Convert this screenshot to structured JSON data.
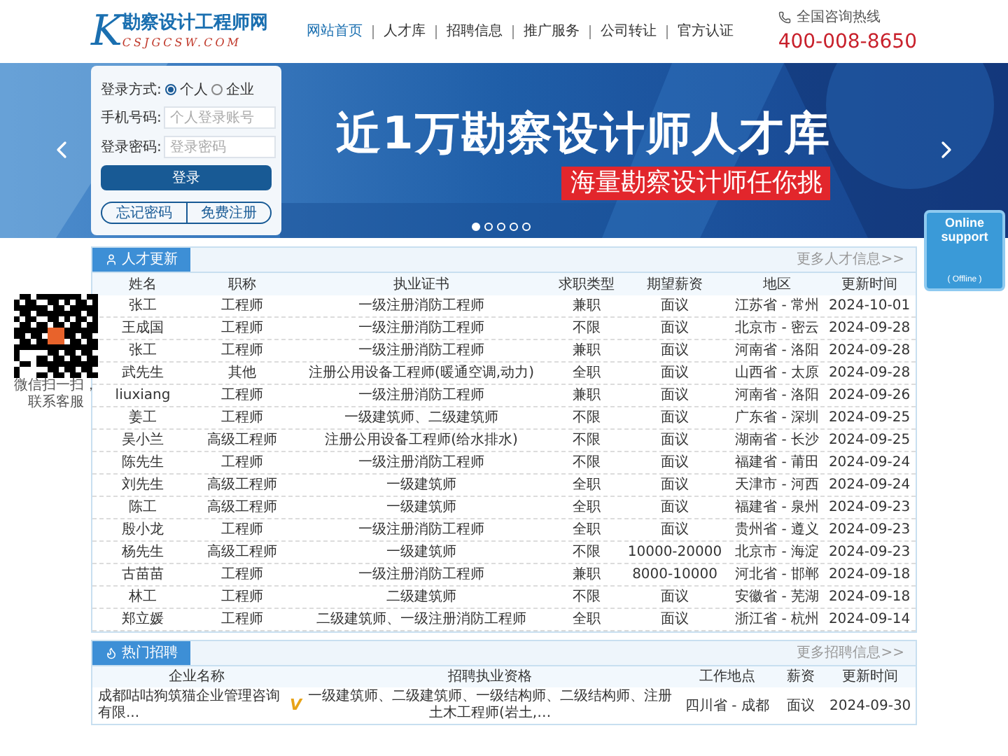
{
  "header": {
    "logo_letter": "K",
    "logo_title": "勘察设计工程师网",
    "logo_domain": "CSJGCSW.COM",
    "nav": [
      {
        "label": "网站首页",
        "selected": true
      },
      {
        "label": "人才库",
        "selected": false
      },
      {
        "label": "招聘信息",
        "selected": false
      },
      {
        "label": "推广服务",
        "selected": false
      },
      {
        "label": "公司转让",
        "selected": false
      },
      {
        "label": "官方认证",
        "selected": false
      }
    ],
    "hotline_label": "全国咨询热线",
    "hotline": "400-008-8650"
  },
  "banner": {
    "headline": "近1万勘察设计师人才库",
    "tagline": "海量勘察设计师任你挑",
    "dots": [
      {
        "selected": true
      },
      {
        "selected": false
      },
      {
        "selected": false
      },
      {
        "selected": false
      },
      {
        "selected": false
      }
    ]
  },
  "login": {
    "mode_label": "登录方式:",
    "modes": [
      {
        "label": "个人",
        "selected": true
      },
      {
        "label": "企业",
        "selected": false
      }
    ],
    "phone_label": "手机号码:",
    "phone_placeholder": "个人登录账号",
    "password_label": "登录密码:",
    "password_placeholder": "登录密码",
    "login_button": "登录",
    "forgot": "忘记密码",
    "register": "免费注册"
  },
  "qr_caption": "微信扫一扫，联系客服",
  "support_widget": {
    "title": "Online support",
    "status": "( Offline )"
  },
  "talent": {
    "tab": "人才更新",
    "more": "更多人才信息>>",
    "columns": [
      "姓名",
      "职称",
      "执业证书",
      "求职类型",
      "期望薪资",
      "地区",
      "更新时间"
    ],
    "rows": [
      [
        "张工",
        "工程师",
        "一级注册消防工程师",
        "兼职",
        "面议",
        "江苏省 - 常州",
        "2024-10-01"
      ],
      [
        "王成国",
        "工程师",
        "一级注册消防工程师",
        "不限",
        "面议",
        "北京市 - 密云",
        "2024-09-28"
      ],
      [
        "张工",
        "工程师",
        "一级注册消防工程师",
        "兼职",
        "面议",
        "河南省 - 洛阳",
        "2024-09-28"
      ],
      [
        "武先生",
        "其他",
        "注册公用设备工程师(暖通空调,动力)",
        "全职",
        "面议",
        "山西省 - 太原",
        "2024-09-28"
      ],
      [
        "liuxiang",
        "工程师",
        "一级注册消防工程师",
        "兼职",
        "面议",
        "河南省 - 洛阳",
        "2024-09-26"
      ],
      [
        "姜工",
        "工程师",
        "一级建筑师、二级建筑师",
        "不限",
        "面议",
        "广东省 - 深圳",
        "2024-09-25"
      ],
      [
        "吴小兰",
        "高级工程师",
        "注册公用设备工程师(给水排水)",
        "不限",
        "面议",
        "湖南省 - 长沙",
        "2024-09-25"
      ],
      [
        "陈先生",
        "工程师",
        "一级注册消防工程师",
        "不限",
        "面议",
        "福建省 - 莆田",
        "2024-09-24"
      ],
      [
        "刘先生",
        "高级工程师",
        "一级建筑师",
        "全职",
        "面议",
        "天津市 - 河西",
        "2024-09-24"
      ],
      [
        "陈工",
        "高级工程师",
        "一级建筑师",
        "全职",
        "面议",
        "福建省 - 泉州",
        "2024-09-23"
      ],
      [
        "殷小龙",
        "工程师",
        "一级注册消防工程师",
        "全职",
        "面议",
        "贵州省 - 遵义",
        "2024-09-23"
      ],
      [
        "杨先生",
        "高级工程师",
        "一级建筑师",
        "不限",
        "10000-20000",
        "北京市 - 海淀",
        "2024-09-23"
      ],
      [
        "古苗苗",
        "工程师",
        "一级注册消防工程师",
        "兼职",
        "8000-10000",
        "河北省 - 邯郸",
        "2024-09-18"
      ],
      [
        "林工",
        "工程师",
        "二级建筑师",
        "不限",
        "面议",
        "安徽省 - 芜湖",
        "2024-09-18"
      ],
      [
        "郑立媛",
        "工程师",
        "二级建筑师、一级注册消防工程师",
        "全职",
        "面议",
        "浙江省 - 杭州",
        "2024-09-14"
      ]
    ]
  },
  "jobs": {
    "tab": "热门招聘",
    "more": "更多招聘信息>>",
    "columns": [
      "企业名称",
      "招聘执业资格",
      "工作地点",
      "薪资",
      "更新时间"
    ],
    "rows": [
      {
        "company": "成都咕咕狗筑猫企业管理咨询有限...",
        "badge": "V",
        "qualifications": "一级建筑师、二级建筑师、一级结构师、二级结构师、注册土木工程师(岩土,…",
        "location": "四川省 - 成都",
        "salary": "面议",
        "updated": "2024-09-30"
      }
    ]
  }
}
